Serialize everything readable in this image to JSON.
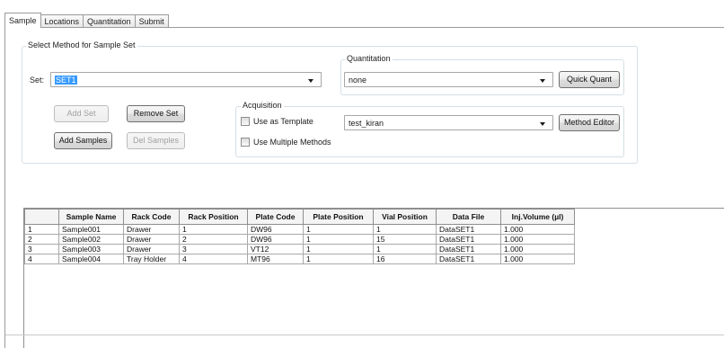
{
  "tabs": [
    {
      "label": "Sample",
      "active": true
    },
    {
      "label": "Locations",
      "active": false
    },
    {
      "label": "Quantitation",
      "active": false
    },
    {
      "label": "Submit",
      "active": false
    }
  ],
  "method_group": {
    "label": "Select Method for Sample Set"
  },
  "set": {
    "label": "Set:",
    "value": "SET1"
  },
  "quantitation": {
    "label": "Quantitation",
    "value": "none",
    "quick_quant_label": "Quick Quant"
  },
  "buttons": {
    "add_set": {
      "label": "Add Set",
      "enabled": false
    },
    "remove_set": {
      "label": "Remove Set",
      "enabled": true
    },
    "add_samples": {
      "label": "Add Samples",
      "enabled": true
    },
    "del_samples": {
      "label": "Del Samples",
      "enabled": false
    }
  },
  "acquisition": {
    "label": "Acquisition",
    "use_as_template_label": "Use as Template",
    "use_as_template_checked": false,
    "use_multiple_methods_label": "Use Multiple Methods",
    "use_multiple_methods_checked": false,
    "method_value": "test_kiran",
    "method_editor_label": "Method Editor"
  },
  "table": {
    "columns": [
      "",
      "Sample Name",
      "Rack Code",
      "Rack Position",
      "Plate Code",
      "Plate Position",
      "Vial Position",
      "Data File",
      "Inj.Volume (µl)"
    ],
    "rows": [
      [
        "1",
        "Sample001",
        "Drawer",
        "1",
        "DW96",
        "1",
        "1",
        "DataSET1",
        "1.000"
      ],
      [
        "2",
        "Sample002",
        "Drawer",
        "2",
        "DW96",
        "1",
        "15",
        "DataSET1",
        "1.000"
      ],
      [
        "3",
        "Sample003",
        "Drawer",
        "3",
        "VT12",
        "1",
        "1",
        "DataSET1",
        "1.000"
      ],
      [
        "4",
        "Sample004",
        "Tray Holder",
        "4",
        "MT96",
        "1",
        "16",
        "DataSET1",
        "1.000"
      ]
    ]
  },
  "icons": {
    "combo_arrow": "chevron-down-icon",
    "checkbox": "checkbox-icon"
  }
}
